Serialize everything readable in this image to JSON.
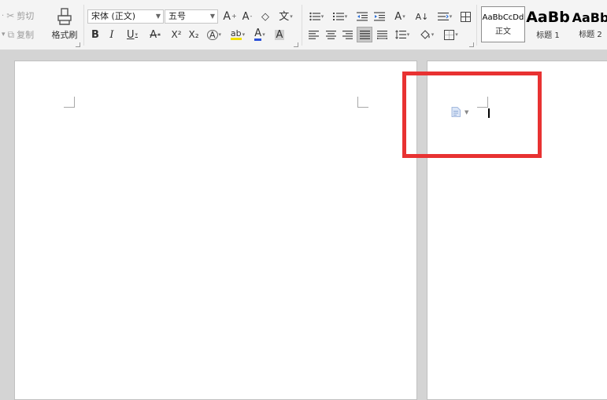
{
  "ribbon": {
    "clipboard": {
      "cut_label": "剪切",
      "copy_label": "复制",
      "format_painter_label": "格式刷"
    },
    "font": {
      "family_value": "宋体 (正文)",
      "size_value": "五号",
      "grow_label": "A",
      "shrink_label": "A",
      "clear_label": "◇",
      "pinyin_label": "文",
      "bold_label": "B",
      "italic_label": "I",
      "underline_label": "U",
      "strike_label": "A",
      "superscript_label": "X²",
      "subscript_label": "X₂",
      "text_effect_label": "A",
      "highlight_label": "ab",
      "font_color_label": "A",
      "char_shading_label": "A"
    },
    "paragraph": {
      "sort_label": "A↓",
      "text_direction_label": "A"
    },
    "styles": [
      {
        "sample": "AaBbCcDd",
        "name": "正文"
      },
      {
        "sample": "AaBb",
        "name": "标题 1"
      },
      {
        "sample": "AaBb",
        "name": "标题 2"
      }
    ]
  },
  "colors": {
    "ribbon_bg": "#f4f4f4",
    "canvas_bg": "#d4d4d4",
    "page_bg": "#ffffff",
    "highlight_border": "#e83232",
    "font_color_bar": "#2b50d8",
    "highlight_bar": "#f2e000"
  }
}
